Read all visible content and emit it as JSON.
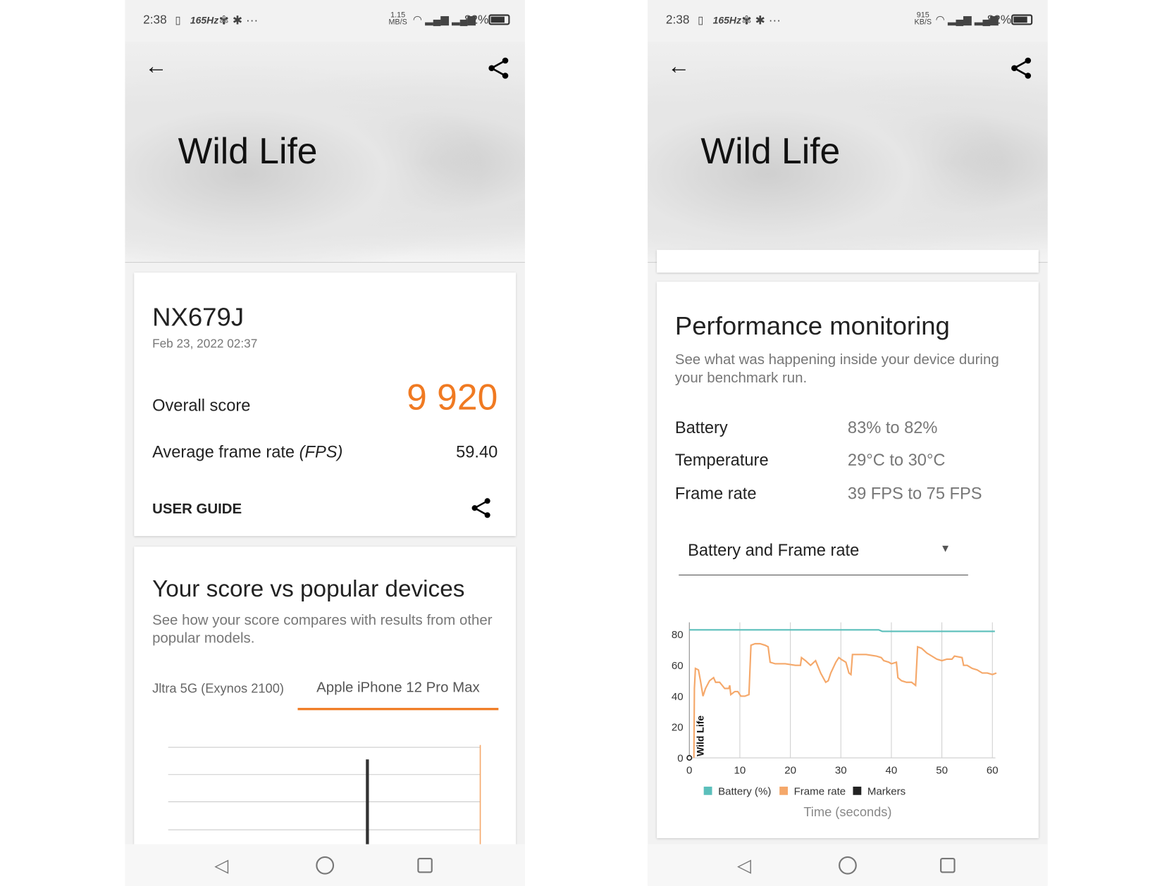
{
  "left": {
    "status": {
      "time": "2:38",
      "refresh": "165Hz",
      "net_speed": "1.15",
      "net_unit": "MB/S",
      "battery": "82%"
    },
    "header": {
      "title": "Wild Life"
    },
    "result": {
      "device": "NX679J",
      "date": "Feb 23, 2022 02:37",
      "overall_label": "Overall score",
      "overall_value": "9 920",
      "fps_label": "Average frame rate ",
      "fps_unit": "(FPS)",
      "fps_value": "59.40",
      "user_guide": "USER GUIDE"
    },
    "compare": {
      "title": "Your score vs popular devices",
      "subtitle": "See how your score compares with results from other popular models.",
      "tabs": [
        {
          "label": "Jltra 5G (Exynos 2100)",
          "selected": false
        },
        {
          "label": "Apple iPhone 12 Pro Max",
          "selected": true
        }
      ]
    }
  },
  "right": {
    "status": {
      "time": "2:38",
      "refresh": "165Hz",
      "net_speed": "915",
      "net_unit": "KB/S",
      "battery": "82%"
    },
    "header": {
      "title": "Wild Life"
    },
    "perf": {
      "title": "Performance monitoring",
      "subtitle": "See what was happening inside your device during your benchmark run.",
      "rows": [
        {
          "label": "Battery",
          "value": "83% to 82%"
        },
        {
          "label": "Temperature",
          "value": "29°C to 30°C"
        },
        {
          "label": "Frame rate",
          "value": "39 FPS to 75 FPS"
        }
      ],
      "dropdown": "Battery and Frame rate"
    }
  },
  "colors": {
    "accent": "#f07a22",
    "battery": "#5bbfbb",
    "framerate": "#f5a86a",
    "markers": "#222222"
  },
  "chart_data": {
    "type": "line",
    "xlabel": "Time (seconds)",
    "ylabel": "",
    "xlim": [
      0,
      60
    ],
    "ylim": [
      0,
      80
    ],
    "xticks": [
      "0",
      "10",
      "20",
      "30",
      "40",
      "50",
      "60"
    ],
    "yticks": [
      "0",
      "20",
      "40",
      "60",
      "80"
    ],
    "grid": "vertical",
    "legend": [
      "Battery (%)",
      "Frame rate",
      "Markers"
    ],
    "legend_placement": "bottom",
    "markers": [
      {
        "x": 1,
        "label": "Wild Life"
      }
    ],
    "series": [
      {
        "name": "Battery (%)",
        "points": [
          [
            0,
            83
          ],
          [
            37.5,
            83
          ],
          [
            38.2,
            82
          ],
          [
            60.5,
            82
          ]
        ]
      },
      {
        "name": "Frame rate",
        "points": [
          [
            0.9,
            0
          ],
          [
            1.0,
            45
          ],
          [
            1.2,
            58
          ],
          [
            1.8,
            57
          ],
          [
            2.2,
            50
          ],
          [
            2.7,
            40
          ],
          [
            3.2,
            45
          ],
          [
            4,
            50
          ],
          [
            4.8,
            52
          ],
          [
            5.2,
            49
          ],
          [
            6,
            49
          ],
          [
            6.5,
            47
          ],
          [
            7,
            45
          ],
          [
            7.8,
            45
          ],
          [
            8,
            47
          ],
          [
            8.2,
            41
          ],
          [
            9,
            43
          ],
          [
            9.6,
            43
          ],
          [
            10.2,
            40
          ],
          [
            11,
            40
          ],
          [
            11.8,
            41
          ],
          [
            12.2,
            73
          ],
          [
            13,
            74
          ],
          [
            14,
            74
          ],
          [
            15,
            73
          ],
          [
            15.6,
            72
          ],
          [
            16,
            62
          ],
          [
            17,
            61
          ],
          [
            19,
            61
          ],
          [
            21,
            60
          ],
          [
            22,
            60
          ],
          [
            22.2,
            65
          ],
          [
            23,
            63
          ],
          [
            24,
            60
          ],
          [
            25,
            63
          ],
          [
            26,
            55
          ],
          [
            27,
            49
          ],
          [
            27.5,
            50
          ],
          [
            28,
            55
          ],
          [
            29,
            62
          ],
          [
            29.6,
            65
          ],
          [
            30,
            64
          ],
          [
            31,
            62
          ],
          [
            31.6,
            55
          ],
          [
            32,
            54
          ],
          [
            32.3,
            67
          ],
          [
            33,
            67
          ],
          [
            35,
            67
          ],
          [
            37,
            66
          ],
          [
            38,
            65
          ],
          [
            38.5,
            63
          ],
          [
            39.5,
            62
          ],
          [
            40,
            61
          ],
          [
            41,
            62
          ],
          [
            41.3,
            52
          ],
          [
            42,
            50
          ],
          [
            43,
            49
          ],
          [
            44,
            49
          ],
          [
            44.8,
            47
          ],
          [
            45.2,
            72
          ],
          [
            46,
            71
          ],
          [
            47,
            68
          ],
          [
            48,
            66
          ],
          [
            49,
            64
          ],
          [
            50,
            63
          ],
          [
            51,
            64
          ],
          [
            52,
            64
          ],
          [
            52.5,
            66
          ],
          [
            54,
            65
          ],
          [
            54.3,
            60
          ],
          [
            55,
            60
          ],
          [
            56,
            58
          ],
          [
            57,
            57
          ],
          [
            58,
            55
          ],
          [
            59,
            55
          ],
          [
            60,
            54
          ],
          [
            60.8,
            55
          ]
        ]
      }
    ]
  }
}
